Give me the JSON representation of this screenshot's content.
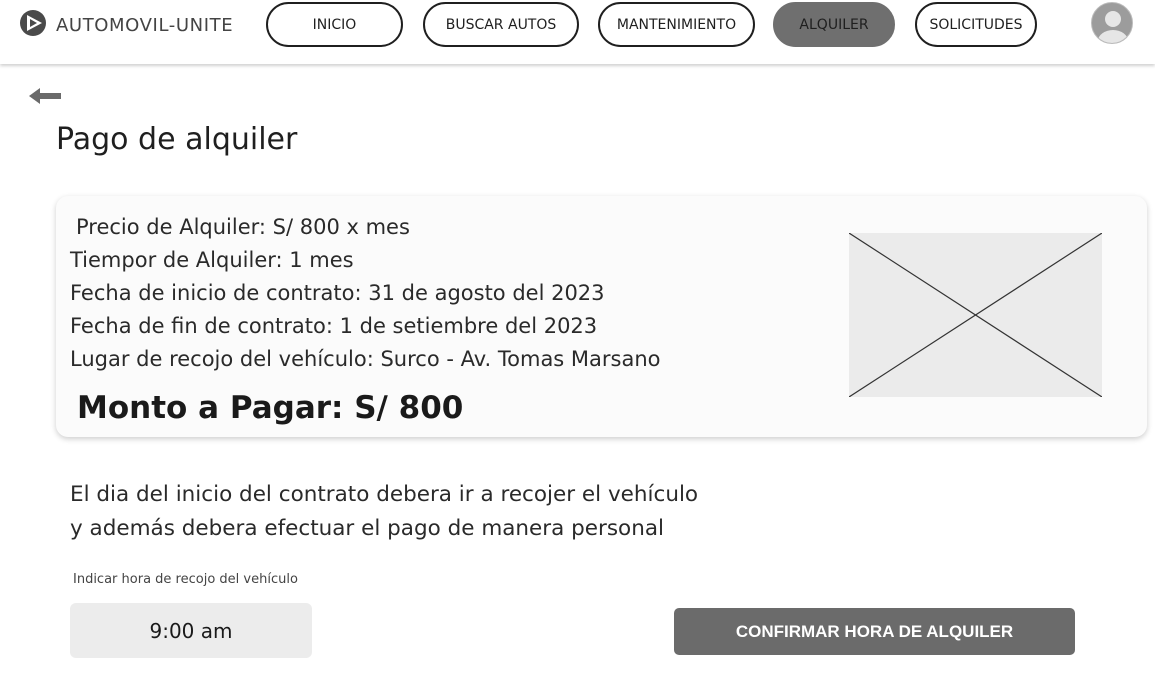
{
  "app": {
    "brand_name": "AUTOMOVIL-UNITE"
  },
  "nav": {
    "inicio": "INICIO",
    "buscar_autos": "BUSCAR AUTOS",
    "mantenimiento": "MANTENIMIENTO",
    "alquiler": "ALQUILER",
    "solicitudes": "SOLICITUDES",
    "active": "alquiler"
  },
  "page": {
    "title": "Pago de alquiler"
  },
  "rental": {
    "price": "Precio de Alquiler:  S/ 800 x mes",
    "duration": "Tiempor de Alquiler: 1 mes",
    "start_date": "Fecha de inicio de contrato: 31 de agosto del 2023",
    "end_date": "Fecha de fin de contrato: 1 de setiembre del 2023",
    "pickup_location": "Lugar de recojo del vehículo: Surco - Av. Tomas Marsano",
    "amount_due": "Monto a Pagar:  S/ 800"
  },
  "notice": {
    "line1": "El dia del inicio del contrato  debera ir a recojer el vehículo",
    "line2": "y además debera efectuar el pago de manera personal"
  },
  "pickup_time": {
    "label": "Indicar hora de recojo del vehículo",
    "value": "9:00 am"
  },
  "actions": {
    "confirm_label": "CONFIRMAR HORA DE ALQUILER"
  },
  "icons": {
    "logo": "play-logo-icon",
    "avatar": "user-avatar-icon",
    "back": "arrow-left-icon",
    "image": "image-placeholder-icon"
  },
  "colors": {
    "active_tab": "#6f6f6f",
    "confirm_button": "#6b6b6b",
    "time_field": "#ececec",
    "card_bg": "#fbfbfb"
  }
}
